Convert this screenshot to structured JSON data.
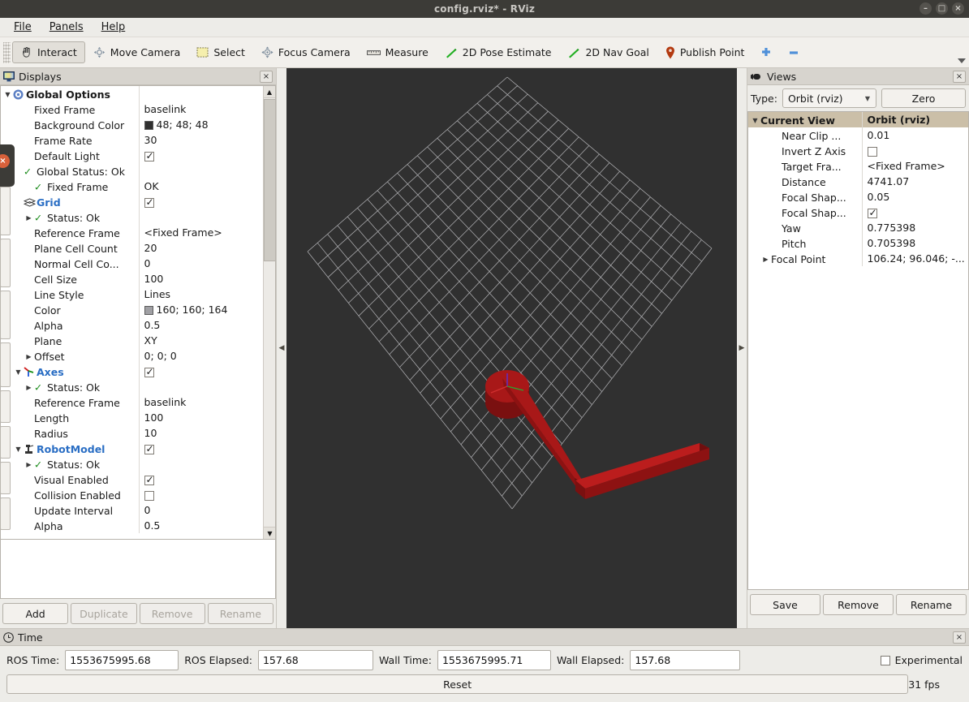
{
  "window": {
    "title": "config.rviz* - RViz",
    "minimize": "–",
    "maximize": "□",
    "close": "×"
  },
  "menubar": {
    "items": [
      {
        "label": "File"
      },
      {
        "label": "Panels"
      },
      {
        "label": "Help"
      }
    ]
  },
  "toolbar": {
    "buttons": [
      {
        "label": "Interact",
        "icon": "hand-cursor-icon",
        "checked": true
      },
      {
        "label": "Move Camera",
        "icon": "move-camera-icon",
        "checked": false
      },
      {
        "label": "Select",
        "icon": "select-rect-icon",
        "checked": false
      },
      {
        "label": "Focus Camera",
        "icon": "focus-camera-icon",
        "checked": false
      },
      {
        "label": "Measure",
        "icon": "ruler-icon",
        "checked": false
      },
      {
        "label": "2D Pose Estimate",
        "icon": "green-arrow-icon",
        "checked": false
      },
      {
        "label": "2D Nav Goal",
        "icon": "green-arrow-icon",
        "checked": false
      },
      {
        "label": "Publish Point",
        "icon": "map-pin-icon",
        "checked": false
      }
    ],
    "add_tool_icon": "plus-icon",
    "remove_tool_icon": "minus-icon",
    "overflow_icon": "chevron-down-icon"
  },
  "displays_panel": {
    "title": "Displays",
    "icon": "monitor-icon",
    "close_icon": "close-icon",
    "rows": [
      {
        "indent": 0,
        "twisty": "▼",
        "icon": "gear-icon",
        "label": "Global Options",
        "bold": true,
        "value_type": "none",
        "value": ""
      },
      {
        "indent": 2,
        "twisty": "",
        "icon": "",
        "label": "Fixed Frame",
        "value_type": "text",
        "value": "baselink"
      },
      {
        "indent": 2,
        "twisty": "",
        "icon": "",
        "label": "Background Color",
        "value_type": "color",
        "value": "48; 48; 48",
        "color": "#303030"
      },
      {
        "indent": 2,
        "twisty": "",
        "icon": "",
        "label": "Frame Rate",
        "value_type": "text",
        "value": "30"
      },
      {
        "indent": 2,
        "twisty": "",
        "icon": "",
        "label": "Default Light",
        "value_type": "check",
        "value": true
      },
      {
        "indent": 1,
        "twisty": "",
        "icon": "ok-check-icon",
        "label": "Global Status: Ok",
        "value_type": "none",
        "value": ""
      },
      {
        "indent": 2,
        "twisty": "",
        "icon": "ok-check-icon",
        "label": "Fixed Frame",
        "value_type": "text",
        "value": "OK"
      },
      {
        "indent": 1,
        "twisty": "",
        "icon": "grid-icon",
        "label": "Grid",
        "cat": true,
        "value_type": "check",
        "value": true
      },
      {
        "indent": 2,
        "twisty": "▶",
        "icon": "ok-check-icon",
        "label": "Status: Ok",
        "value_type": "none",
        "value": ""
      },
      {
        "indent": 2,
        "twisty": "",
        "icon": "",
        "label": "Reference Frame",
        "value_type": "text",
        "value": "<Fixed Frame>"
      },
      {
        "indent": 2,
        "twisty": "",
        "icon": "",
        "label": "Plane Cell Count",
        "value_type": "text",
        "value": "20"
      },
      {
        "indent": 2,
        "twisty": "",
        "icon": "",
        "label": "Normal Cell Co...",
        "value_type": "text",
        "value": "0"
      },
      {
        "indent": 2,
        "twisty": "",
        "icon": "",
        "label": "Cell Size",
        "value_type": "text",
        "value": "100"
      },
      {
        "indent": 2,
        "twisty": "",
        "icon": "",
        "label": "Line Style",
        "value_type": "text",
        "value": "Lines"
      },
      {
        "indent": 2,
        "twisty": "",
        "icon": "",
        "label": "Color",
        "value_type": "color",
        "value": "160; 160; 164",
        "color": "#a0a0a4"
      },
      {
        "indent": 2,
        "twisty": "",
        "icon": "",
        "label": "Alpha",
        "value_type": "text",
        "value": "0.5"
      },
      {
        "indent": 2,
        "twisty": "",
        "icon": "",
        "label": "Plane",
        "value_type": "text",
        "value": "XY"
      },
      {
        "indent": 2,
        "twisty": "▶",
        "icon": "",
        "label": "Offset",
        "value_type": "text",
        "value": "0; 0; 0"
      },
      {
        "indent": 1,
        "twisty": "▼",
        "icon": "axes-icon",
        "label": "Axes",
        "cat": true,
        "value_type": "check",
        "value": true
      },
      {
        "indent": 2,
        "twisty": "▶",
        "icon": "ok-check-icon",
        "label": "Status: Ok",
        "value_type": "none",
        "value": ""
      },
      {
        "indent": 2,
        "twisty": "",
        "icon": "",
        "label": "Reference Frame",
        "value_type": "text",
        "value": "baselink"
      },
      {
        "indent": 2,
        "twisty": "",
        "icon": "",
        "label": "Length",
        "value_type": "text",
        "value": "100"
      },
      {
        "indent": 2,
        "twisty": "",
        "icon": "",
        "label": "Radius",
        "value_type": "text",
        "value": "10"
      },
      {
        "indent": 1,
        "twisty": "▼",
        "icon": "robot-icon",
        "label": "RobotModel",
        "cat": true,
        "value_type": "check",
        "value": true
      },
      {
        "indent": 2,
        "twisty": "▶",
        "icon": "ok-check-icon",
        "label": "Status: Ok",
        "value_type": "none",
        "value": ""
      },
      {
        "indent": 2,
        "twisty": "",
        "icon": "",
        "label": "Visual Enabled",
        "value_type": "check",
        "value": true
      },
      {
        "indent": 2,
        "twisty": "",
        "icon": "",
        "label": "Collision Enabled",
        "value_type": "check",
        "value": false
      },
      {
        "indent": 2,
        "twisty": "",
        "icon": "",
        "label": "Update Interval",
        "value_type": "text",
        "value": "0"
      },
      {
        "indent": 2,
        "twisty": "",
        "icon": "",
        "label": "Alpha",
        "value_type": "text",
        "value": "0.5"
      }
    ],
    "buttons": [
      {
        "label": "Add",
        "enabled": true
      },
      {
        "label": "Duplicate",
        "enabled": false
      },
      {
        "label": "Remove",
        "enabled": false
      },
      {
        "label": "Rename",
        "enabled": false
      }
    ]
  },
  "views_panel": {
    "title": "Views",
    "icon": "camera-icon",
    "close_icon": "close-icon",
    "type_label": "Type:",
    "type_value": "Orbit (rviz)",
    "zero_label": "Zero",
    "rows": [
      {
        "indent": 0,
        "twisty": "▼",
        "label": "Current View",
        "selected": true,
        "value_type": "text",
        "value": "Orbit (rviz)"
      },
      {
        "indent": 2,
        "twisty": "",
        "label": "Near Clip ...",
        "value_type": "text",
        "value": "0.01"
      },
      {
        "indent": 2,
        "twisty": "",
        "label": "Invert Z Axis",
        "value_type": "check",
        "value": false
      },
      {
        "indent": 2,
        "twisty": "",
        "label": "Target Fra...",
        "value_type": "text",
        "value": "<Fixed Frame>"
      },
      {
        "indent": 2,
        "twisty": "",
        "label": "Distance",
        "value_type": "text",
        "value": "4741.07"
      },
      {
        "indent": 2,
        "twisty": "",
        "label": "Focal Shap...",
        "value_type": "text",
        "value": "0.05"
      },
      {
        "indent": 2,
        "twisty": "",
        "label": "Focal Shap...",
        "value_type": "check",
        "value": true
      },
      {
        "indent": 2,
        "twisty": "",
        "label": "Yaw",
        "value_type": "text",
        "value": "0.775398"
      },
      {
        "indent": 2,
        "twisty": "",
        "label": "Pitch",
        "value_type": "text",
        "value": "0.705398"
      },
      {
        "indent": 1,
        "twisty": "▶",
        "label": "Focal Point",
        "value_type": "text",
        "value": "106.24; 96.046; -..."
      }
    ],
    "buttons": [
      {
        "label": "Save",
        "enabled": true
      },
      {
        "label": "Remove",
        "enabled": true
      },
      {
        "label": "Rename",
        "enabled": true
      }
    ]
  },
  "time_panel": {
    "title": "Time",
    "icon": "clock-icon",
    "close_icon": "close-icon",
    "fields": [
      {
        "label": "ROS Time:",
        "value": "1553675995.68"
      },
      {
        "label": "ROS Elapsed:",
        "value": "157.68"
      },
      {
        "label": "Wall Time:",
        "value": "1553675995.71"
      },
      {
        "label": "Wall Elapsed:",
        "value": "157.68"
      }
    ],
    "experimental_label": "Experimental",
    "experimental_checked": false,
    "reset_label": "Reset",
    "fps": "31 fps"
  },
  "viewport": {
    "background_color": "#303030",
    "grid_color": "#c8c8cc",
    "robot_color": "#a11515",
    "collapse_left_icon": "◀",
    "collapse_right_icon": "▶"
  }
}
